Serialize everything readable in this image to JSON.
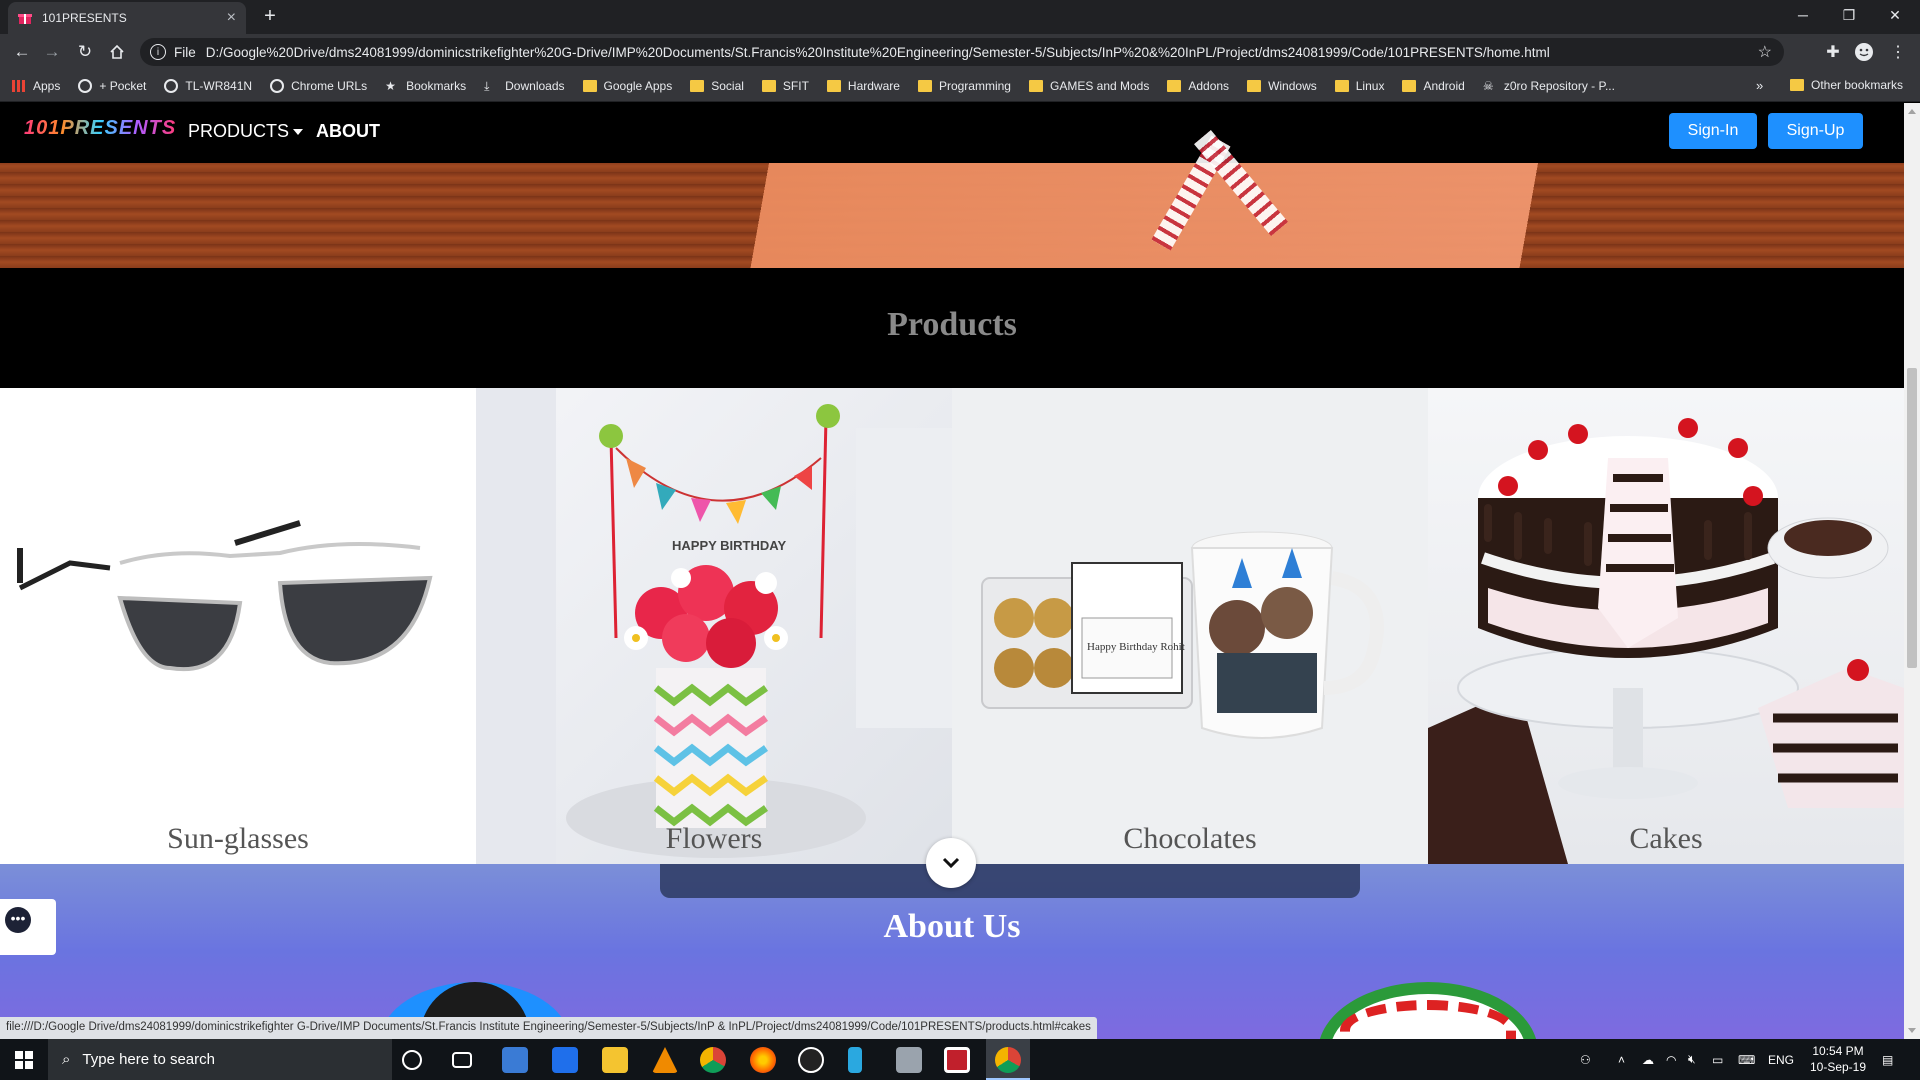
{
  "browser": {
    "tab_title": "101PRESENTS",
    "new_tab_glyph": "+",
    "window_controls": {
      "minimize": "─",
      "restore": "❐",
      "close": "✕"
    },
    "address_scheme": "File",
    "address_url": "D:/Google%20Drive/dms24081999/dominicstrikefighter%20G-Drive/IMP%20Documents/St.Francis%20Institute%20Engineering/Semester-5/Subjects/InP%20&%20InPL/Project/dms24081999/Code/101PRESENTS/home.html",
    "bookmarks": [
      {
        "label": "Apps",
        "icon": "apps-grid-icon"
      },
      {
        "label": "+ Pocket",
        "icon": "globe-icon"
      },
      {
        "label": "TL-WR841N",
        "icon": "globe-icon"
      },
      {
        "label": "Chrome URLs",
        "icon": "globe-icon"
      },
      {
        "label": "Bookmarks",
        "icon": "star-icon"
      },
      {
        "label": "Downloads",
        "icon": "download-icon"
      },
      {
        "label": "Google Apps",
        "icon": "folder-icon"
      },
      {
        "label": "Social",
        "icon": "folder-icon"
      },
      {
        "label": "SFIT",
        "icon": "folder-icon"
      },
      {
        "label": "Hardware",
        "icon": "folder-icon"
      },
      {
        "label": "Programming",
        "icon": "folder-icon"
      },
      {
        "label": "GAMES and Mods",
        "icon": "folder-icon"
      },
      {
        "label": "Addons",
        "icon": "folder-icon"
      },
      {
        "label": "Windows",
        "icon": "folder-icon"
      },
      {
        "label": "Linux",
        "icon": "folder-icon"
      },
      {
        "label": "Android",
        "icon": "folder-icon"
      },
      {
        "label": "z0ro Repository - P...",
        "icon": "pirate-icon"
      }
    ],
    "bookmarks_overflow": "»",
    "other_bookmarks": "Other bookmarks",
    "status_url": "file:///D:/Google Drive/dms24081999/dominicstrikefighter G-Drive/IMP Documents/St.Francis Institute Engineering/Semester-5/Subjects/InP & InPL/Project/dms24081999/Code/101PRESENTS/products.html#cakes"
  },
  "site": {
    "logo_text": "101PRESENTS",
    "nav": {
      "products": "PRODUCTS",
      "about": "ABOUT"
    },
    "signin": "Sign-In",
    "signup": "Sign-Up",
    "products_title": "Products",
    "products": [
      {
        "label": "Sun-glasses"
      },
      {
        "label": "Flowers"
      },
      {
        "label": "Chocolates"
      },
      {
        "label": "Cakes"
      }
    ],
    "about_title": "About Us",
    "banner_text": "HAPPY BIRTHDAY",
    "mug_note": "Happy Birthday Rohit"
  },
  "taskbar": {
    "search_placeholder": "Type here to search",
    "language": "ENG",
    "time": "10:54 PM",
    "date": "10-Sep-19"
  },
  "colors": {
    "accent_button": "#1e90ff",
    "products_title": "#8a8a8a",
    "about_gradient": "#6a74e0"
  }
}
